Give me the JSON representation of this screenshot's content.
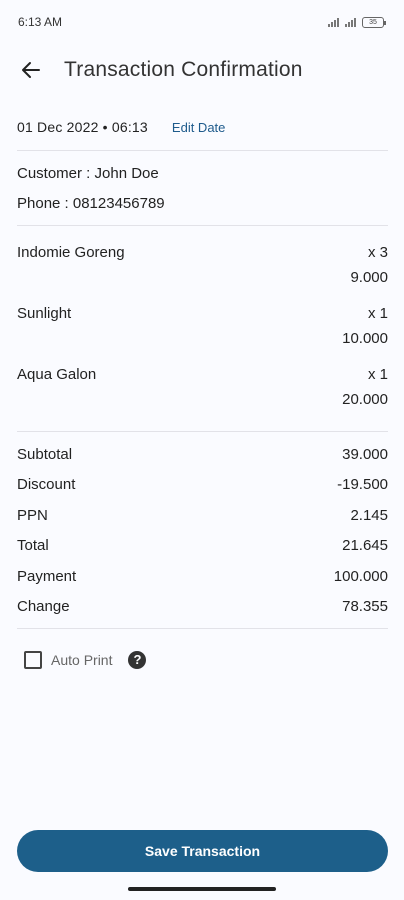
{
  "status_bar": {
    "time": "6:13 AM",
    "battery": "35"
  },
  "header": {
    "title": "Transaction Confirmation",
    "back_icon": "arrow-left-icon"
  },
  "date_row": {
    "date": "01 Dec 2022 • 06:13",
    "edit_label": "Edit Date"
  },
  "customer": {
    "name_line": "Customer : John Doe",
    "phone_line": "Phone : 08123456789"
  },
  "items": [
    {
      "name": "Indomie Goreng",
      "qty": "x 3",
      "price": "9.000"
    },
    {
      "name": "Sunlight",
      "qty": "x 1",
      "price": "10.000"
    },
    {
      "name": "Aqua Galon",
      "qty": "x 1",
      "price": "20.000"
    }
  ],
  "summary": [
    {
      "label": "Subtotal",
      "value": "39.000"
    },
    {
      "label": "Discount",
      "value": "-19.500"
    },
    {
      "label": "PPN",
      "value": "2.145"
    },
    {
      "label": "Total",
      "value": "21.645"
    },
    {
      "label": "Payment",
      "value": "100.000"
    },
    {
      "label": "Change",
      "value": "78.355"
    }
  ],
  "auto_print": {
    "label": "Auto Print",
    "checked": false,
    "help_icon": "question-circle-icon"
  },
  "save_button": {
    "label": "Save Transaction"
  },
  "colors": {
    "accent": "#1d5f8a",
    "link": "#1e5b8c",
    "background": "#fafbff"
  }
}
